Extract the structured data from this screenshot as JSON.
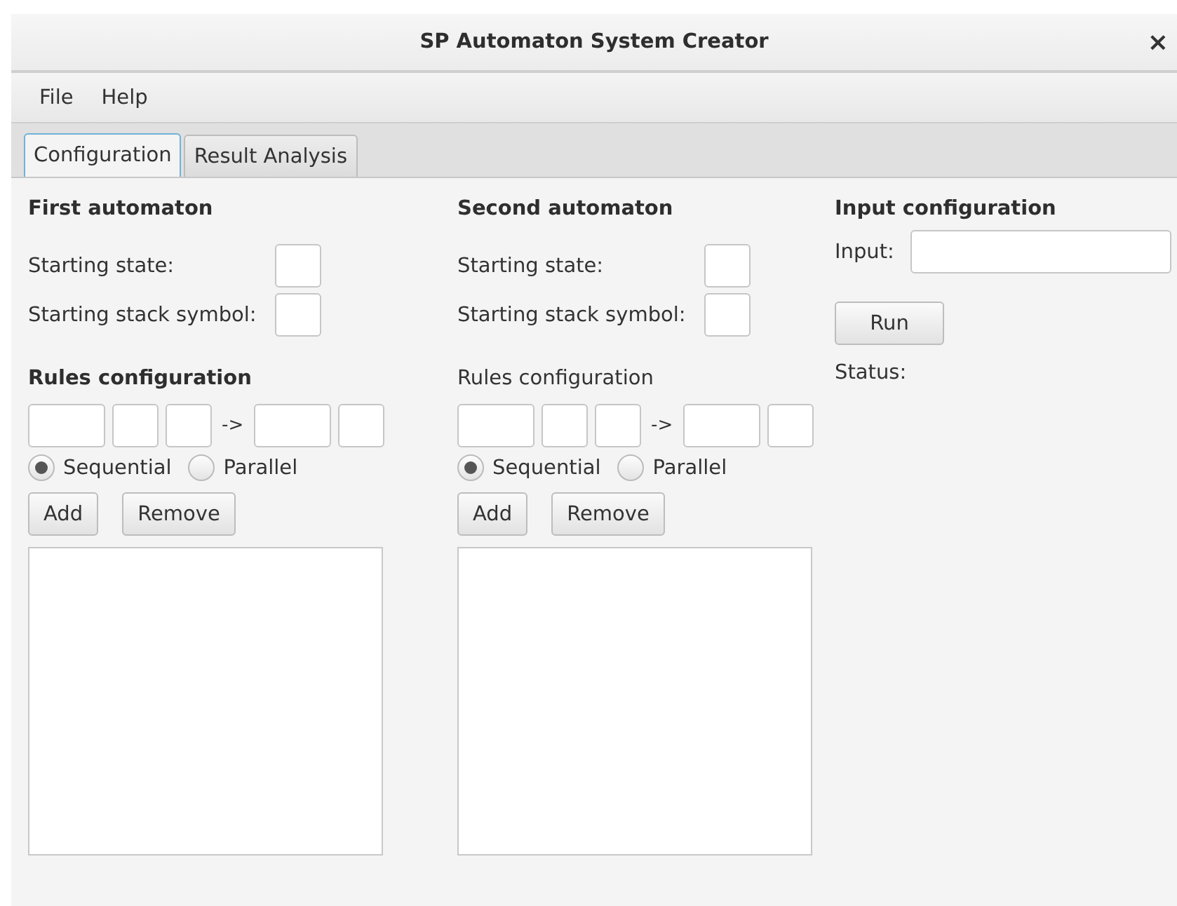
{
  "window": {
    "title": "SP Automaton System Creator",
    "close": "×"
  },
  "menu": [
    "File",
    "Help"
  ],
  "tabs": [
    {
      "label": "Configuration",
      "selected": true
    },
    {
      "label": "Result Analysis",
      "selected": false
    }
  ],
  "automata": [
    {
      "heading": "First automaton",
      "starting_state_label": "Starting state:",
      "starting_stack_label": "Starting stack symbol:",
      "rules_heading": "Rules configuration",
      "rules_heading_bold": true,
      "arrow": "->",
      "modes": [
        {
          "label": "Sequential",
          "selected": true
        },
        {
          "label": "Parallel",
          "selected": false
        }
      ],
      "buttons": [
        "Add",
        "Remove"
      ]
    },
    {
      "heading": "Second automaton",
      "starting_state_label": "Starting state:",
      "starting_stack_label": "Starting stack symbol:",
      "rules_heading": "Rules configuration",
      "rules_heading_bold": false,
      "arrow": "->",
      "modes": [
        {
          "label": "Sequential",
          "selected": true
        },
        {
          "label": "Parallel",
          "selected": false
        }
      ],
      "buttons": [
        "Add",
        "Remove"
      ]
    }
  ],
  "input_config": {
    "heading": "Input configuration",
    "input_label": "Input:",
    "run_button": "Run",
    "status_label": "Status:"
  }
}
